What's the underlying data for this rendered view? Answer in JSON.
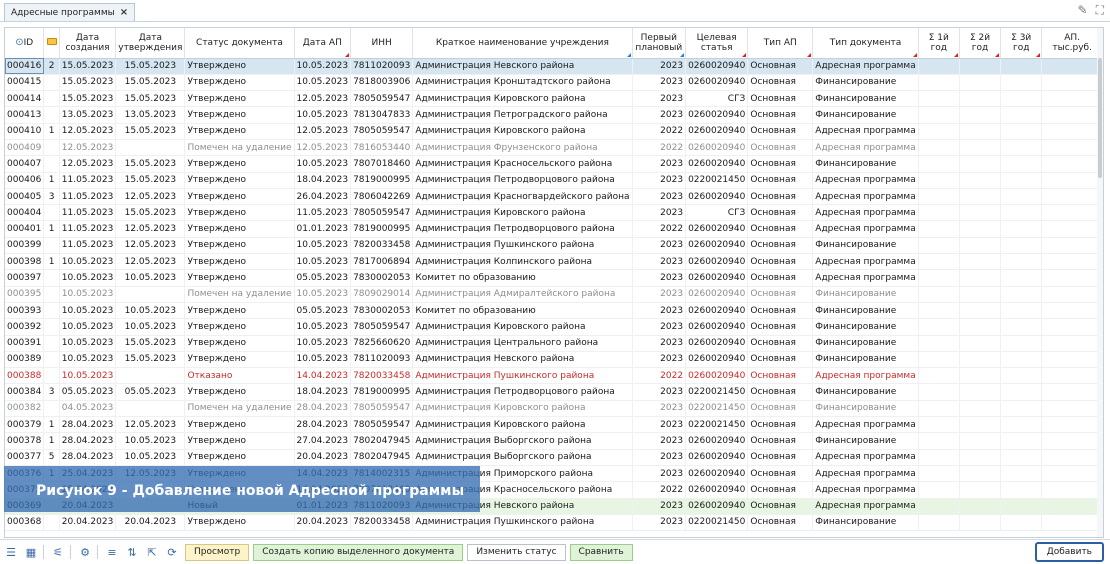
{
  "tab": {
    "title": "Адресные программы",
    "close": "×"
  },
  "window_icons": {
    "edit": "✎",
    "expand": "⛶"
  },
  "columns": [
    {
      "key": "id",
      "label": "ID",
      "w": 30
    },
    {
      "key": "att",
      "label": "",
      "w": 16
    },
    {
      "key": "created",
      "label": "Дата создания",
      "w": 52
    },
    {
      "key": "approved",
      "label": "Дата утверждения",
      "w": 52
    },
    {
      "key": "status",
      "label": "Статус документа",
      "w": 88
    },
    {
      "key": "ap_date",
      "label": "Дата АП",
      "w": 48
    },
    {
      "key": "inn",
      "label": "ИНН",
      "w": 52
    },
    {
      "key": "name",
      "label": "Краткое наименование учреждения",
      "w": 162
    },
    {
      "key": "year",
      "label": "Первый плановый",
      "w": 56
    },
    {
      "key": "art",
      "label": "Целевая статья",
      "w": 60
    },
    {
      "key": "ap_type",
      "label": "Тип АП",
      "w": 86
    },
    {
      "key": "doc_type",
      "label": "Тип документа",
      "w": 86
    },
    {
      "key": "s1",
      "label": "Σ 1й год",
      "w": 70
    },
    {
      "key": "s2",
      "label": "Σ 2й год",
      "w": 70
    },
    {
      "key": "s3",
      "label": "Σ 3й год",
      "w": 70
    },
    {
      "key": "ap_sum",
      "label": "АП. тыс.руб.",
      "w": 84
    }
  ],
  "rows": [
    {
      "id": "000416",
      "att": "2",
      "created": "15.05.2023",
      "approved": "15.05.2023",
      "status": "Утверждено",
      "ap_date": "10.05.2023",
      "inn": "7811020093",
      "name": "Администрация Невского района",
      "year": "2023",
      "art": "0260020940",
      "ap_type": "Основная",
      "doc_type": "Адресная программа",
      "style": "sel"
    },
    {
      "id": "000415",
      "att": "",
      "created": "15.05.2023",
      "approved": "15.05.2023",
      "status": "Утверждено",
      "ap_date": "10.05.2023",
      "inn": "7818003906",
      "name": "Администрация Кронштадтского района",
      "year": "2023",
      "art": "0260020940",
      "ap_type": "Основная",
      "doc_type": "Финансирование",
      "style": ""
    },
    {
      "id": "000414",
      "att": "",
      "created": "15.05.2023",
      "approved": "15.05.2023",
      "status": "Утверждено",
      "ap_date": "12.05.2023",
      "inn": "7805059547",
      "name": "Администрация Кировского района",
      "year": "2023",
      "art": "СГЗ",
      "ap_type": "Основная",
      "doc_type": "Финансирование",
      "style": ""
    },
    {
      "id": "000413",
      "att": "",
      "created": "13.05.2023",
      "approved": "13.05.2023",
      "status": "Утверждено",
      "ap_date": "10.05.2023",
      "inn": "7813047833",
      "name": "Администрация Петроградского района",
      "year": "2023",
      "art": "0260020940",
      "ap_type": "Основная",
      "doc_type": "Финансирование",
      "style": ""
    },
    {
      "id": "000410",
      "att": "1",
      "created": "12.05.2023",
      "approved": "15.05.2023",
      "status": "Утверждено",
      "ap_date": "12.05.2023",
      "inn": "7805059547",
      "name": "Администрация Кировского района",
      "year": "2022",
      "art": "0260020940",
      "ap_type": "Основная",
      "doc_type": "Адресная программа",
      "style": ""
    },
    {
      "id": "000409",
      "att": "",
      "created": "12.05.2023",
      "approved": "",
      "status": "Помечен на удаление",
      "ap_date": "12.05.2023",
      "inn": "7816053440",
      "name": "Администрация Фрунзенского района",
      "year": "2022",
      "art": "0260020940",
      "ap_type": "Основная",
      "doc_type": "Адресная программа",
      "style": "grey"
    },
    {
      "id": "000407",
      "att": "",
      "created": "12.05.2023",
      "approved": "15.05.2023",
      "status": "Утверждено",
      "ap_date": "10.05.2023",
      "inn": "7807018460",
      "name": "Администрация Красносельского района",
      "year": "2023",
      "art": "0260020940",
      "ap_type": "Основная",
      "doc_type": "Финансирование",
      "style": ""
    },
    {
      "id": "000406",
      "att": "1",
      "created": "11.05.2023",
      "approved": "15.05.2023",
      "status": "Утверждено",
      "ap_date": "18.04.2023",
      "inn": "7819000995",
      "name": "Администрация Петродворцового района",
      "year": "2023",
      "art": "0220021450",
      "ap_type": "Основная",
      "doc_type": "Адресная программа",
      "style": ""
    },
    {
      "id": "000405",
      "att": "3",
      "created": "11.05.2023",
      "approved": "12.05.2023",
      "status": "Утверждено",
      "ap_date": "26.04.2023",
      "inn": "7806042269",
      "name": "Администрация Красногвардейского района",
      "year": "2023",
      "art": "0260020940",
      "ap_type": "Основная",
      "doc_type": "Адресная программа",
      "style": ""
    },
    {
      "id": "000404",
      "att": "",
      "created": "11.05.2023",
      "approved": "15.05.2023",
      "status": "Утверждено",
      "ap_date": "11.05.2023",
      "inn": "7805059547",
      "name": "Администрация Кировского района",
      "year": "2023",
      "art": "СГЗ",
      "ap_type": "Основная",
      "doc_type": "Адресная программа",
      "style": ""
    },
    {
      "id": "000401",
      "att": "1",
      "created": "11.05.2023",
      "approved": "12.05.2023",
      "status": "Утверждено",
      "ap_date": "01.01.2023",
      "inn": "7819000995",
      "name": "Администрация Петродворцового района",
      "year": "2022",
      "art": "0260020940",
      "ap_type": "Основная",
      "doc_type": "Адресная программа",
      "style": ""
    },
    {
      "id": "000399",
      "att": "",
      "created": "11.05.2023",
      "approved": "12.05.2023",
      "status": "Утверждено",
      "ap_date": "10.05.2023",
      "inn": "7820033458",
      "name": "Администрация Пушкинского района",
      "year": "2023",
      "art": "0260020940",
      "ap_type": "Основная",
      "doc_type": "Финансирование",
      "style": ""
    },
    {
      "id": "000398",
      "att": "1",
      "created": "10.05.2023",
      "approved": "12.05.2023",
      "status": "Утверждено",
      "ap_date": "10.05.2023",
      "inn": "7817006894",
      "name": "Администрация Колпинского района",
      "year": "2023",
      "art": "0260020940",
      "ap_type": "Основная",
      "doc_type": "Адресная программа",
      "style": ""
    },
    {
      "id": "000397",
      "att": "",
      "created": "10.05.2023",
      "approved": "10.05.2023",
      "status": "Утверждено",
      "ap_date": "05.05.2023",
      "inn": "7830002053",
      "name": "Комитет по образованию",
      "year": "2023",
      "art": "0260020940",
      "ap_type": "Основная",
      "doc_type": "Адресная программа",
      "style": ""
    },
    {
      "id": "000395",
      "att": "",
      "created": "10.05.2023",
      "approved": "",
      "status": "Помечен на удаление",
      "ap_date": "10.05.2023",
      "inn": "7809029014",
      "name": "Администрация Адмиралтейского района",
      "year": "2023",
      "art": "0260020940",
      "ap_type": "Основная",
      "doc_type": "Финансирование",
      "style": "grey"
    },
    {
      "id": "000393",
      "att": "",
      "created": "10.05.2023",
      "approved": "10.05.2023",
      "status": "Утверждено",
      "ap_date": "05.05.2023",
      "inn": "7830002053",
      "name": "Комитет по образованию",
      "year": "2023",
      "art": "0260020940",
      "ap_type": "Основная",
      "doc_type": "Финансирование",
      "style": ""
    },
    {
      "id": "000392",
      "att": "",
      "created": "10.05.2023",
      "approved": "10.05.2023",
      "status": "Утверждено",
      "ap_date": "10.05.2023",
      "inn": "7805059547",
      "name": "Администрация Кировского района",
      "year": "2023",
      "art": "0260020940",
      "ap_type": "Основная",
      "doc_type": "Финансирование",
      "style": ""
    },
    {
      "id": "000391",
      "att": "",
      "created": "10.05.2023",
      "approved": "15.05.2023",
      "status": "Утверждено",
      "ap_date": "10.05.2023",
      "inn": "7825660620",
      "name": "Администрация Центрального района",
      "year": "2023",
      "art": "0260020940",
      "ap_type": "Основная",
      "doc_type": "Финансирование",
      "style": ""
    },
    {
      "id": "000389",
      "att": "",
      "created": "10.05.2023",
      "approved": "15.05.2023",
      "status": "Утверждено",
      "ap_date": "10.05.2023",
      "inn": "7811020093",
      "name": "Администрация Невского района",
      "year": "2023",
      "art": "0260020940",
      "ap_type": "Основная",
      "doc_type": "Финансирование",
      "style": ""
    },
    {
      "id": "000388",
      "att": "",
      "created": "10.05.2023",
      "approved": "",
      "status": "Отказано",
      "ap_date": "14.04.2023",
      "inn": "7820033458",
      "name": "Администрация Пушкинского района",
      "year": "2022",
      "art": "0260020940",
      "ap_type": "Основная",
      "doc_type": "Адресная программа",
      "style": "red"
    },
    {
      "id": "000384",
      "att": "3",
      "created": "05.05.2023",
      "approved": "05.05.2023",
      "status": "Утверждено",
      "ap_date": "18.04.2023",
      "inn": "7819000995",
      "name": "Администрация Петродворцового района",
      "year": "2023",
      "art": "0220021450",
      "ap_type": "Основная",
      "doc_type": "Финансирование",
      "style": ""
    },
    {
      "id": "000382",
      "att": "",
      "created": "04.05.2023",
      "approved": "",
      "status": "Помечен на удаление",
      "ap_date": "28.04.2023",
      "inn": "7805059547",
      "name": "Администрация Кировского района",
      "year": "2023",
      "art": "0220021450",
      "ap_type": "Основная",
      "doc_type": "Финансирование",
      "style": "grey"
    },
    {
      "id": "000379",
      "att": "1",
      "created": "28.04.2023",
      "approved": "12.05.2023",
      "status": "Утверждено",
      "ap_date": "28.04.2023",
      "inn": "7805059547",
      "name": "Администрация Кировского района",
      "year": "2023",
      "art": "0220021450",
      "ap_type": "Основная",
      "doc_type": "Адресная программа",
      "style": ""
    },
    {
      "id": "000378",
      "att": "1",
      "created": "28.04.2023",
      "approved": "10.05.2023",
      "status": "Утверждено",
      "ap_date": "27.04.2023",
      "inn": "7802047945",
      "name": "Администрация Выборгского района",
      "year": "2023",
      "art": "0260020940",
      "ap_type": "Основная",
      "doc_type": "Финансирование",
      "style": ""
    },
    {
      "id": "000377",
      "att": "5",
      "created": "28.04.2023",
      "approved": "10.05.2023",
      "status": "Утверждено",
      "ap_date": "20.04.2023",
      "inn": "7802047945",
      "name": "Администрация Выборгского района",
      "year": "2023",
      "art": "0260020940",
      "ap_type": "Основная",
      "doc_type": "Адресная программа",
      "style": ""
    },
    {
      "id": "000376",
      "att": "1",
      "created": "25.04.2023",
      "approved": "12.05.2023",
      "status": "Утверждено",
      "ap_date": "14.04.2023",
      "inn": "7814002315",
      "name": "Администрация Приморского района",
      "year": "2023",
      "art": "0260020940",
      "ap_type": "Основная",
      "doc_type": "Адресная программа",
      "style": ""
    },
    {
      "id": "000375",
      "att": "",
      "created": "25.04.2023",
      "approved": "",
      "status": "Утверждено",
      "ap_date": "14.04.2023",
      "inn": "7807018460",
      "name": "Администрация Красносельского района",
      "year": "2022",
      "art": "0260020940",
      "ap_type": "Основная",
      "doc_type": "Адресная программа",
      "style": ""
    },
    {
      "id": "000369",
      "att": "",
      "created": "20.04.2023",
      "approved": "",
      "status": "Новый",
      "ap_date": "01.01.2023",
      "inn": "7811020093",
      "name": "Администрация Невского района",
      "year": "2023",
      "art": "0260020940",
      "ap_type": "Основная",
      "doc_type": "Адресная программа",
      "style": "green"
    },
    {
      "id": "000368",
      "att": "",
      "created": "20.04.2023",
      "approved": "20.04.2023",
      "status": "Утверждено",
      "ap_date": "20.04.2023",
      "inn": "7820033458",
      "name": "Администрация Пушкинского района",
      "year": "2023",
      "art": "0220021450",
      "ap_type": "Основная",
      "doc_type": "Финансирование",
      "style": ""
    }
  ],
  "overlay_caption": "Рисунок 9 - Добавление новой Адресной программы",
  "toolbar": {
    "view": "Просмотр",
    "copy": "Создать копию выделенного документа",
    "change_status": "Изменить статус",
    "compare": "Сравнить",
    "add": "Добавить"
  }
}
